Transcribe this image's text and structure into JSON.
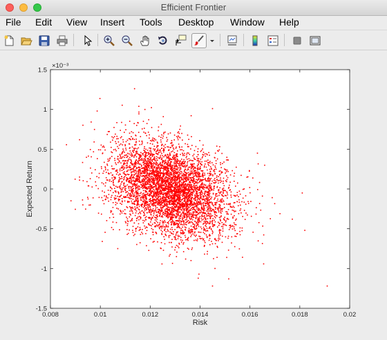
{
  "window": {
    "title": "Efficient Frontier"
  },
  "menu": [
    "File",
    "Edit",
    "View",
    "Insert",
    "Tools",
    "Desktop",
    "Window",
    "Help"
  ],
  "toolbar": {
    "buttons": [
      "new-figure",
      "open-file",
      "save",
      "print",
      "edit-plot-arrow",
      "zoom-in",
      "zoom-out",
      "pan",
      "rotate-3d",
      "data-cursor",
      "brush",
      "brush-dropdown",
      "link-plot",
      "insert-colorbar",
      "insert-legend",
      "hide-plot-tools",
      "show-plot-tools"
    ]
  },
  "colors": {
    "marker": "#ff0000",
    "axes_bg": "#ffffff",
    "figure_bg": "#ececec"
  },
  "chart_data": {
    "type": "scatter",
    "xlabel": "Risk",
    "ylabel": "Expected Return",
    "y_exponent": "×10⁻³",
    "xlim": [
      0.008,
      0.02
    ],
    "ylim": [
      -1.5,
      1.5
    ],
    "xticks": [
      "0.008",
      "0.01",
      "0.012",
      "0.014",
      "0.016",
      "0.018",
      "0.02"
    ],
    "yticks": [
      "-1.5",
      "-1",
      "-0.5",
      "0",
      "0.5",
      "1",
      "1.5"
    ],
    "y_unit_scale": 0.001,
    "point_count": 5000,
    "cloud": {
      "risk_mean": 0.0128,
      "risk_sd": 0.0012,
      "return_mean": 0.0,
      "return_sd": 0.3,
      "correlation": -0.3
    },
    "outliers": [
      {
        "x": 0.0191,
        "y": -1.22
      },
      {
        "x": 0.0145,
        "y": -1.22
      },
      {
        "x": 0.0145,
        "y": 1.01
      },
      {
        "x": 0.0181,
        "y": -0.05
      },
      {
        "x": 0.0163,
        "y": 0.45
      },
      {
        "x": 0.0177,
        "y": -0.38
      },
      {
        "x": 0.0182,
        "y": -0.52
      },
      {
        "x": 0.0093,
        "y": -0.2
      },
      {
        "x": 0.0107,
        "y": -0.75
      },
      {
        "x": 0.0146,
        "y": -1.0
      }
    ],
    "grid": false,
    "legend": "none"
  }
}
